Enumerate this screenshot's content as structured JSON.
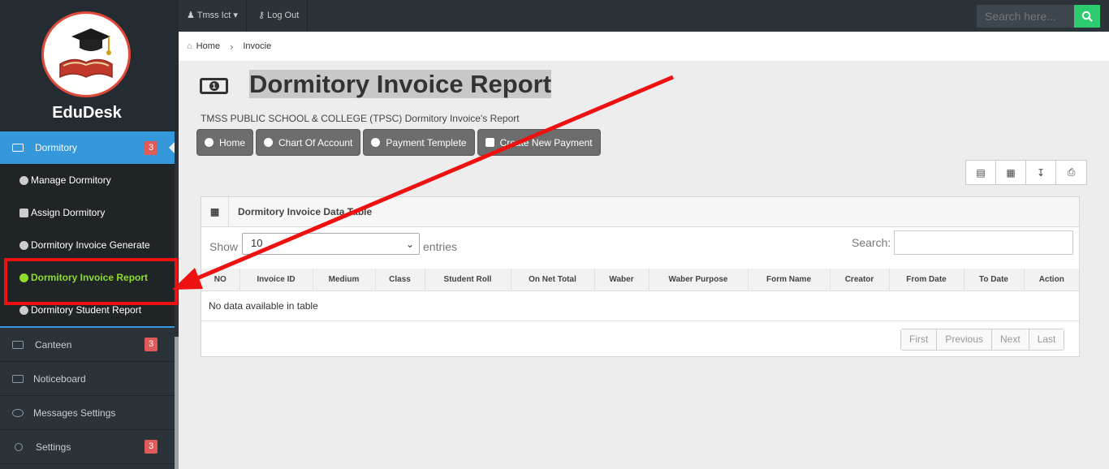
{
  "app": {
    "brand": "EduDesk"
  },
  "topbar": {
    "user_label": "Tmss Ict",
    "logout_label": "Log Out",
    "search_placeholder": "Search here..."
  },
  "breadcrumb": {
    "home": "Home",
    "current": "Invocie"
  },
  "sidebar": {
    "dormitory": {
      "label": "Dormitory",
      "badge": "3"
    },
    "submenu": [
      {
        "label": "Manage Dormitory"
      },
      {
        "label": "Assign Dormitory"
      },
      {
        "label": "Dormitory Invoice Generate"
      },
      {
        "label": "Dormitory Invoice Report"
      },
      {
        "label": "Dormitory Student Report"
      }
    ],
    "items": [
      {
        "label": "Canteen",
        "badge": "3"
      },
      {
        "label": "Noticeboard"
      },
      {
        "label": "Messages Settings"
      },
      {
        "label": "Settings",
        "badge": "3"
      }
    ]
  },
  "page": {
    "title": "Dormitory Invoice Report",
    "subtitle": "TMSS PUBLIC SCHOOL & COLLEGE (TPSC) Dormitory Invoice's Report",
    "buttons": [
      "Home",
      "Chart Of Account",
      "Payment Templete",
      "Create New Payment"
    ]
  },
  "table": {
    "heading": "Dormitory Invoice Data Table",
    "show_label": "Show",
    "page_size": "10",
    "entries_label": "entries",
    "search_label": "Search:",
    "columns": [
      "NO",
      "Invoice ID",
      "Medium",
      "Class",
      "Student Roll",
      "On Net Total",
      "Waber",
      "Waber Purpose",
      "Form Name",
      "Creator",
      "From Date",
      "To Date",
      "Action"
    ],
    "empty_text": "No data available in table",
    "pagination": [
      "First",
      "Previous",
      "Next",
      "Last"
    ]
  },
  "colors": {
    "accent": "#3498db",
    "active_sub": "#8fdc2a",
    "annotation": "#ee1111",
    "search_button": "#2ecc71"
  }
}
